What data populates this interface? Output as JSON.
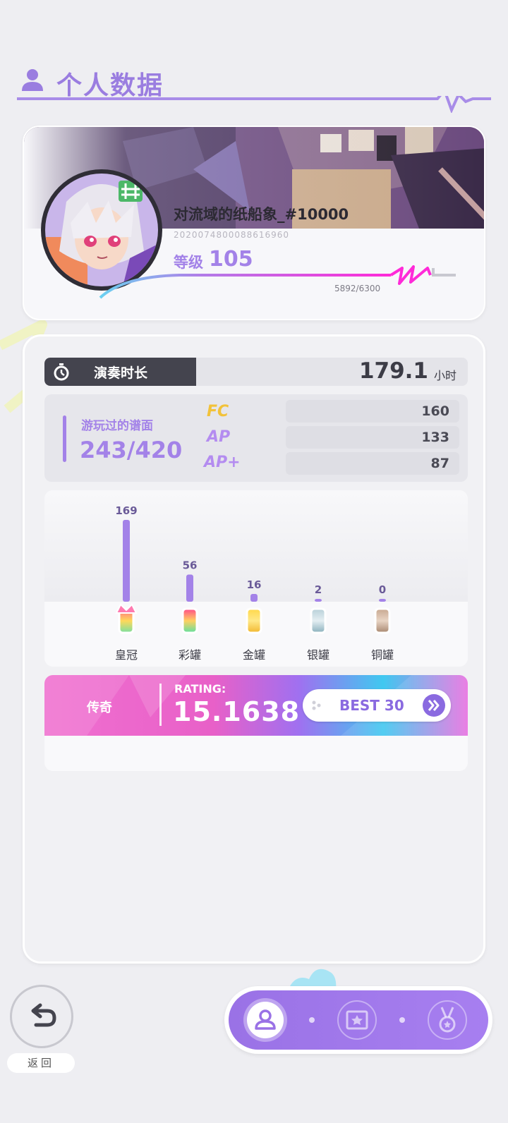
{
  "header": {
    "title": "个人数据"
  },
  "profile": {
    "username": "对流域的纸船象_#10000",
    "uid": "2020074800088616960",
    "level_label": "等级",
    "level": "105",
    "xp_text": "5892/6300",
    "xp_progress": 0.935
  },
  "playtime": {
    "label": "演奏时长",
    "value": "179.1",
    "unit": "小时"
  },
  "charts": {
    "label": "游玩过的谱面",
    "value": "243/420",
    "badges": [
      {
        "name": "FC",
        "value": "160",
        "color": "#f2c23a"
      },
      {
        "name": "AP",
        "value": "133",
        "color": "#b48cf0"
      },
      {
        "name": "AP+",
        "value": "87",
        "color": "#b48cf0"
      }
    ]
  },
  "chart_data": {
    "type": "bar",
    "categories": [
      "皇冠",
      "彩罐",
      "金罐",
      "银罐",
      "铜罐"
    ],
    "values": [
      169,
      56,
      16,
      2,
      0
    ],
    "value_labels": [
      "169",
      "56",
      "16",
      "2",
      "0"
    ],
    "bar_color": "#a382e8"
  },
  "rating": {
    "tier": "传奇",
    "caption": "RATING:",
    "value": "15.1638",
    "best_button": "BEST 30"
  },
  "bottom": {
    "back_label": "返回",
    "nav": [
      "profile-icon",
      "photo-frame-icon",
      "medal-icon"
    ]
  },
  "colors": {
    "accent": "#a382e8",
    "dark_tag": "#44444e",
    "background": "#eeeef2"
  }
}
